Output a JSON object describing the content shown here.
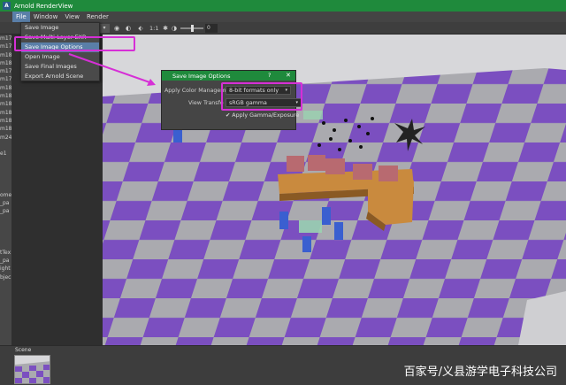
{
  "window": {
    "title": "Arnold RenderView",
    "icon": "arnold-app-icon"
  },
  "menubar": {
    "items": [
      "File",
      "Window",
      "View",
      "Render"
    ]
  },
  "toolbar": {
    "ratio_label": "1:1",
    "exposure_value": "0"
  },
  "left_panel": {
    "items": [
      "m17",
      "m17",
      "m18",
      "m18",
      "m17",
      "m17",
      "m18",
      "m18",
      "m18",
      "m18",
      "m18",
      "m18",
      "m24",
      "",
      "e1",
      "",
      "",
      "",
      "",
      "ome",
      "_pa",
      "_pa",
      "",
      "",
      "",
      "",
      "tTex",
      "_pa",
      "ight",
      "bjec"
    ]
  },
  "file_menu": {
    "items": [
      "Save Image",
      "Save Multi-Layer EXR",
      "Save Image Options",
      "Open Image",
      "Save Final Images",
      "Export Arnold Scene"
    ],
    "highlighted": "Save Image Options"
  },
  "dialog": {
    "title": "Save Image Options",
    "help": "?",
    "close": "✕",
    "color_manager_label": "Apply Color Managem",
    "color_manager_value": "8-bit formats only",
    "view_transform_label": "View Transfo",
    "view_transform_value": "sRGB gamma",
    "gamma_checkbox_label": "Apply Gamma/Exposure",
    "gamma_checked": true
  },
  "bottom": {
    "thumb_label": "Scene"
  },
  "watermark": "百家号/义县游学电子科技公司",
  "colors": {
    "titlebar": "#1f8a3c",
    "highlight": "#d62fd6",
    "menu_selected": "#5a7fa8",
    "checker_purple": "#7b4fc0",
    "checker_gray": "#aaaaaf"
  }
}
